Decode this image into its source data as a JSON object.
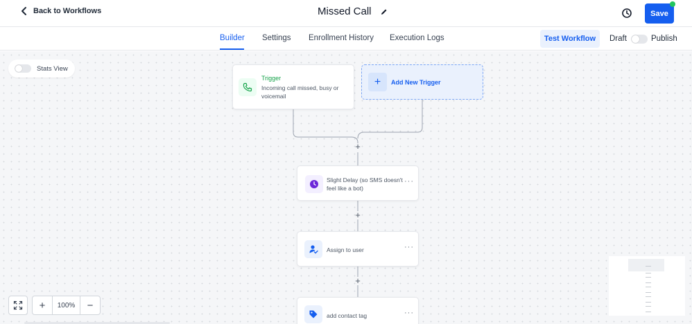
{
  "header": {
    "back_label": "Back to Workflows",
    "title": "Missed Call",
    "save_label": "Save"
  },
  "tabs": [
    {
      "label": "Builder",
      "active": true
    },
    {
      "label": "Settings",
      "active": false
    },
    {
      "label": "Enrollment History",
      "active": false
    },
    {
      "label": "Execution Logs",
      "active": false
    }
  ],
  "toolbar": {
    "test_label": "Test Workflow",
    "draft_label": "Draft",
    "publish_label": "Publish",
    "publish_on": false
  },
  "canvas": {
    "stats_label": "Stats View",
    "stats_on": false,
    "trigger": {
      "label": "Trigger",
      "description": "Incoming call missed, busy or voicemail",
      "icon": "phone-icon"
    },
    "add_trigger_label": "Add New Trigger",
    "actions": [
      {
        "label": "Slight Delay (so SMS doesn't feel like a bot)",
        "icon": "clock-icon"
      },
      {
        "label": "Assign to user",
        "icon": "user-assign-icon"
      },
      {
        "label": "add contact tag",
        "icon": "tag-icon"
      }
    ],
    "zoom": "100%"
  },
  "colors": {
    "accent": "#155eef",
    "trigger_green": "#16a34a",
    "delay_purple": "#6d28d9",
    "status_dot": "#22c55e"
  }
}
